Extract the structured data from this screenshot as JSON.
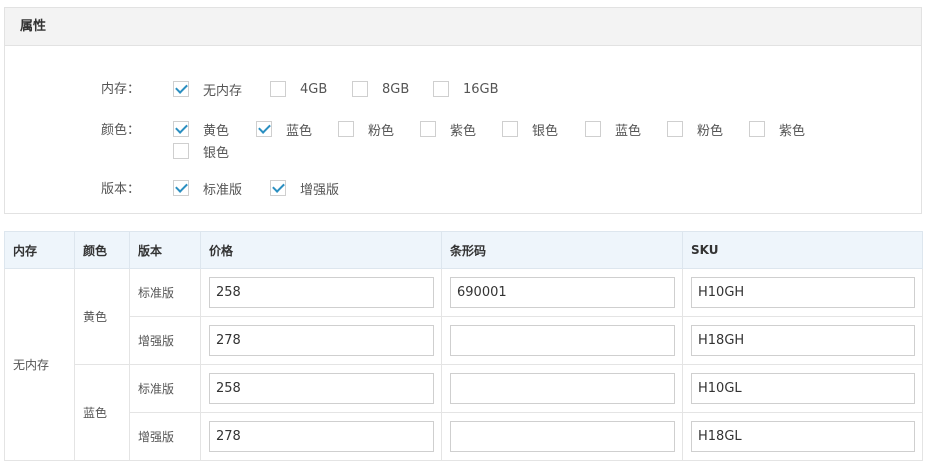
{
  "panel": {
    "title": "属性",
    "rows": [
      {
        "label": "内存：",
        "options": [
          {
            "label": "无内存",
            "checked": true
          },
          {
            "label": "4GB",
            "checked": false
          },
          {
            "label": "8GB",
            "checked": false
          },
          {
            "label": "16GB",
            "checked": false
          }
        ]
      },
      {
        "label": "颜色：",
        "options": [
          {
            "label": "黄色",
            "checked": true
          },
          {
            "label": "蓝色",
            "checked": true
          },
          {
            "label": "粉色",
            "checked": false
          },
          {
            "label": "紫色",
            "checked": false
          },
          {
            "label": "银色",
            "checked": false
          },
          {
            "label": "蓝色",
            "checked": false
          },
          {
            "label": "粉色",
            "checked": false
          },
          {
            "label": "紫色",
            "checked": false
          },
          {
            "label": "银色",
            "checked": false
          }
        ]
      },
      {
        "label": "版本：",
        "options": [
          {
            "label": "标准版",
            "checked": true
          },
          {
            "label": "增强版",
            "checked": true
          }
        ]
      }
    ]
  },
  "table": {
    "headers": {
      "memory": "内存",
      "color": "颜色",
      "version": "版本",
      "price": "价格",
      "barcode": "条形码",
      "sku": "SKU"
    },
    "memory_group": "无内存",
    "color_groups": [
      "黄色",
      "蓝色"
    ],
    "rows": [
      {
        "version": "标准版",
        "price": "258",
        "barcode": "690001",
        "sku": "H10GH"
      },
      {
        "version": "增强版",
        "price": "278",
        "barcode": "",
        "sku": "H18GH"
      },
      {
        "version": "标准版",
        "price": "258",
        "barcode": "",
        "sku": "H10GL"
      },
      {
        "version": "增强版",
        "price": "278",
        "barcode": "",
        "sku": "H18GL"
      }
    ]
  },
  "colors": {
    "check_color": "#2b8fc1",
    "header_bg": "#f3f3f3",
    "table_header_bg": "#eef5fb"
  }
}
